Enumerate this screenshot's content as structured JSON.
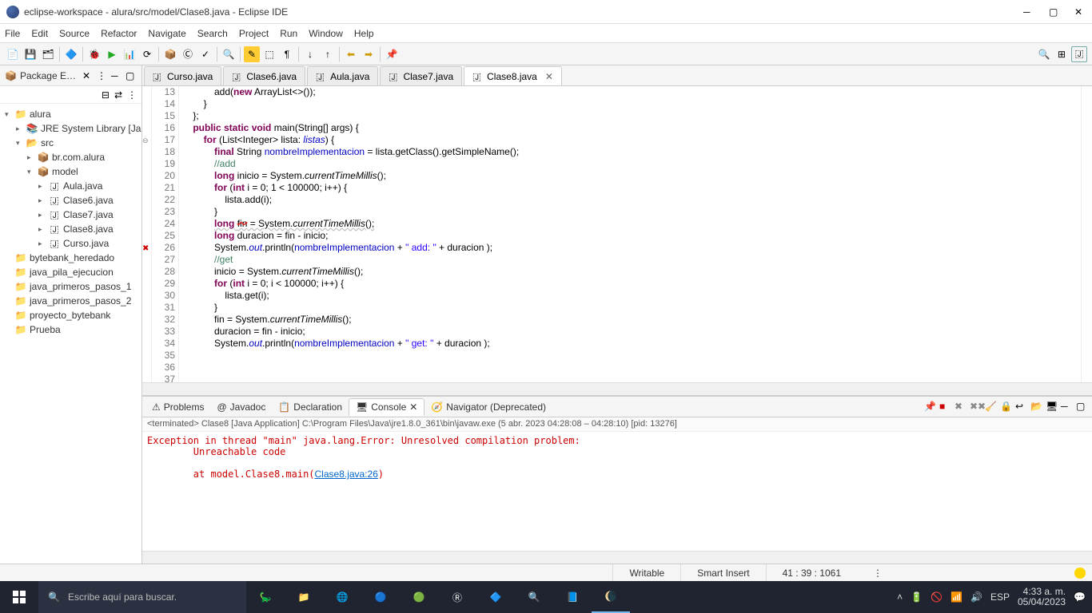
{
  "title": "eclipse-workspace - alura/src/model/Clase8.java - Eclipse IDE",
  "menu": [
    "File",
    "Edit",
    "Source",
    "Refactor",
    "Navigate",
    "Search",
    "Project",
    "Run",
    "Window",
    "Help"
  ],
  "package_explorer": {
    "title": "Package E…",
    "tree": [
      {
        "level": 0,
        "arrow": "▾",
        "icon": "project",
        "label": "alura"
      },
      {
        "level": 1,
        "arrow": "▸",
        "icon": "jre",
        "label": "JRE System Library [Ja"
      },
      {
        "level": 1,
        "arrow": "▾",
        "icon": "src",
        "label": "src"
      },
      {
        "level": 2,
        "arrow": "▸",
        "icon": "package",
        "label": "br.com.alura"
      },
      {
        "level": 2,
        "arrow": "▾",
        "icon": "package",
        "label": "model"
      },
      {
        "level": 3,
        "arrow": "▸",
        "icon": "java",
        "label": "Aula.java"
      },
      {
        "level": 3,
        "arrow": "▸",
        "icon": "java",
        "label": "Clase6.java"
      },
      {
        "level": 3,
        "arrow": "▸",
        "icon": "java",
        "label": "Clase7.java"
      },
      {
        "level": 3,
        "arrow": "▸",
        "icon": "java",
        "label": "Clase8.java"
      },
      {
        "level": 3,
        "arrow": "▸",
        "icon": "java",
        "label": "Curso.java"
      },
      {
        "level": 0,
        "arrow": "",
        "icon": "folder",
        "label": "bytebank_heredado"
      },
      {
        "level": 0,
        "arrow": "",
        "icon": "folder",
        "label": "java_pila_ejecucion"
      },
      {
        "level": 0,
        "arrow": "",
        "icon": "folder",
        "label": "java_primeros_pasos_1"
      },
      {
        "level": 0,
        "arrow": "",
        "icon": "folder",
        "label": "java_primeros_pasos_2"
      },
      {
        "level": 0,
        "arrow": "",
        "icon": "folder",
        "label": "proyecto_bytebank"
      },
      {
        "level": 0,
        "arrow": "",
        "icon": "folder",
        "label": "Prueba"
      }
    ]
  },
  "editor_tabs": [
    {
      "label": "Curso.java",
      "active": false
    },
    {
      "label": "Clase6.java",
      "active": false
    },
    {
      "label": "Aula.java",
      "active": false
    },
    {
      "label": "Clase7.java",
      "active": false
    },
    {
      "label": "Clase8.java",
      "active": true
    }
  ],
  "code_lines": [
    {
      "n": 13,
      "html": "            add(<span class='kw'>new</span> ArrayList&lt;&gt;());"
    },
    {
      "n": 14,
      "html": "        }"
    },
    {
      "n": 15,
      "html": "    };"
    },
    {
      "n": 16,
      "html": ""
    },
    {
      "n": 17,
      "html": "    <span class='kw'>public static void</span> main(String[] args) {"
    },
    {
      "n": 18,
      "html": "        <span class='kw'>for</span> (List&lt;Integer&gt; lista: <span class='it fin'>listas</span>) {"
    },
    {
      "n": 19,
      "html": "            <span class='kw'>final</span> String <span class='fin'>nombreImplementacion</span> = lista.getClass().getSimpleName();"
    },
    {
      "n": 20,
      "html": ""
    },
    {
      "n": 21,
      "html": "            <span class='com'>//add</span>"
    },
    {
      "n": 22,
      "html": "            <span class='kw'>long</span> inicio = System.<span class='it'>currentTimeMillis</span>();"
    },
    {
      "n": 23,
      "html": "            <span class='kw'>for</span> (<span class='kw'>int</span> i = 0; 1 &lt; 100000; i++) {"
    },
    {
      "n": 24,
      "html": "                lista.add(i);"
    },
    {
      "n": 25,
      "html": "            }"
    },
    {
      "n": 26,
      "html": "            <span class='underline-err'><span class='kw'>long</span> <span class='err'>fin</span> = System.<span class='it'>currentTimeMillis</span>();</span>"
    },
    {
      "n": 27,
      "html": "            <span class='kw'>long</span> duracion = fin - inicio;"
    },
    {
      "n": 28,
      "html": "            System.<span class='it fin'>out</span>.println(<span class='fin'>nombreImplementacion</span> + <span class='str'>\" add: \"</span> + duracion );"
    },
    {
      "n": 29,
      "html": ""
    },
    {
      "n": 30,
      "html": "            <span class='com'>//get</span>"
    },
    {
      "n": 31,
      "html": "            inicio = System.<span class='it'>currentTimeMillis</span>();"
    },
    {
      "n": 32,
      "html": "            <span class='kw'>for</span> (<span class='kw'>int</span> i = 0; i &lt; 100000; i++) {"
    },
    {
      "n": 33,
      "html": "                lista.get(i);"
    },
    {
      "n": 34,
      "html": "            }"
    },
    {
      "n": 35,
      "html": "            fin = System.<span class='it'>currentTimeMillis</span>();"
    },
    {
      "n": 36,
      "html": "            duracion = fin - inicio;"
    },
    {
      "n": 37,
      "html": "            System.<span class='it fin'>out</span>.println(<span class='fin'>nombreImplementacion</span> + <span class='str'>\" get: \"</span> + duracion );"
    }
  ],
  "bottom_tabs": [
    {
      "label": "Problems",
      "active": false
    },
    {
      "label": "Javadoc",
      "active": false
    },
    {
      "label": "Declaration",
      "active": false
    },
    {
      "label": "Console",
      "active": true
    },
    {
      "label": "Navigator (Deprecated)",
      "active": false
    }
  ],
  "console": {
    "header": "<terminated> Clase8 [Java Application] C:\\Program Files\\Java\\jre1.8.0_361\\bin\\javaw.exe  (5 abr. 2023 04:28:08 – 04:28:10) [pid: 13276]",
    "lines": [
      "Exception in thread \"main\" java.lang.Error: Unresolved compilation problem: ",
      "        Unreachable code",
      "",
      "        at model.Clase8.main("
    ],
    "link": "Clase8.java:26",
    "after_link": ")"
  },
  "status": {
    "writable": "Writable",
    "insert": "Smart Insert",
    "pos": "41 : 39 : 1061"
  },
  "taskbar": {
    "search_placeholder": "Escribe aquí para buscar.",
    "time": "4:33 a. m.",
    "date": "05/04/2023"
  }
}
